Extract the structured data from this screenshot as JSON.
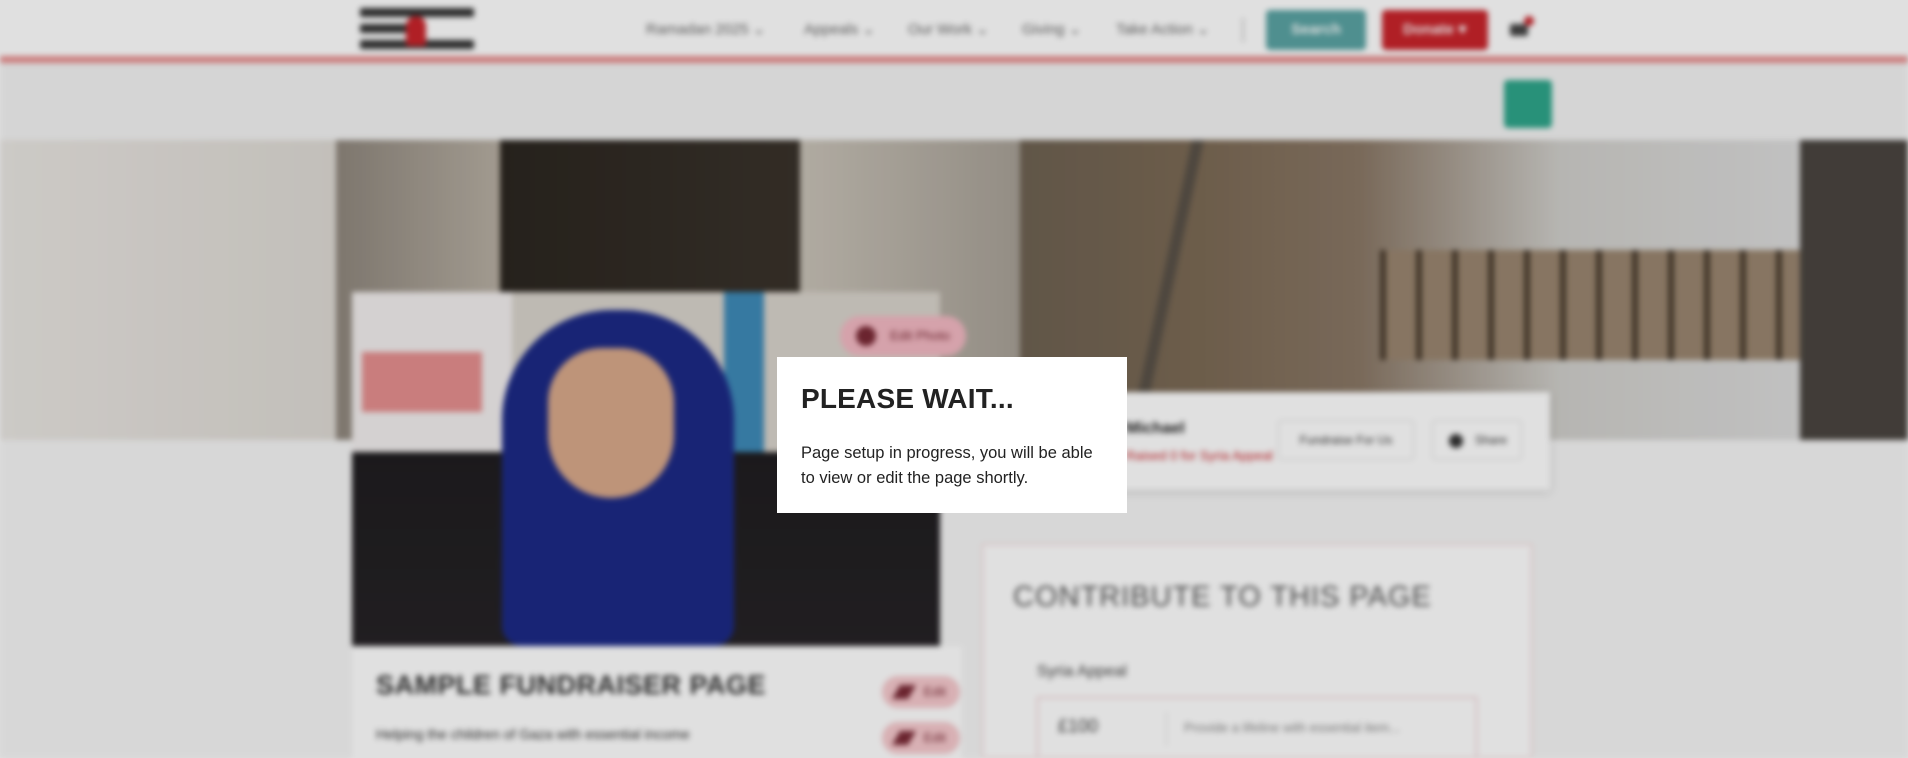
{
  "nav": {
    "items": [
      "Ramadan 2025",
      "Appeals",
      "Our Work",
      "Giving",
      "Take Action"
    ],
    "search_label": "Search",
    "donate_label": "Donate"
  },
  "hero": {
    "photo_tag": "Edit Photo"
  },
  "organiser": {
    "name": "Michael",
    "subtitle": "Raised 0 for Syria Appeal",
    "fundraise_label": "Fundraise For Us",
    "share_label": "Share"
  },
  "page": {
    "title": "SAMPLE FUNDRAISER PAGE",
    "subtitle": "Helping the children of Gaza with essential income",
    "edit_labels": [
      "Edit",
      "Edit"
    ]
  },
  "contribute": {
    "title": "CONTRIBUTE TO THIS PAGE",
    "appeal_label": "Syria Appeal",
    "amount": "£100",
    "placeholder": "Provide a lifeline with essential item..."
  },
  "modal": {
    "title": "PLEASE WAIT...",
    "body": "Page setup in progress, you will be able to view or edit the page shortly."
  },
  "colors": {
    "brand_red": "#c9242b",
    "search_teal": "#5aa3a3",
    "accent_green": "#2ea58a"
  }
}
